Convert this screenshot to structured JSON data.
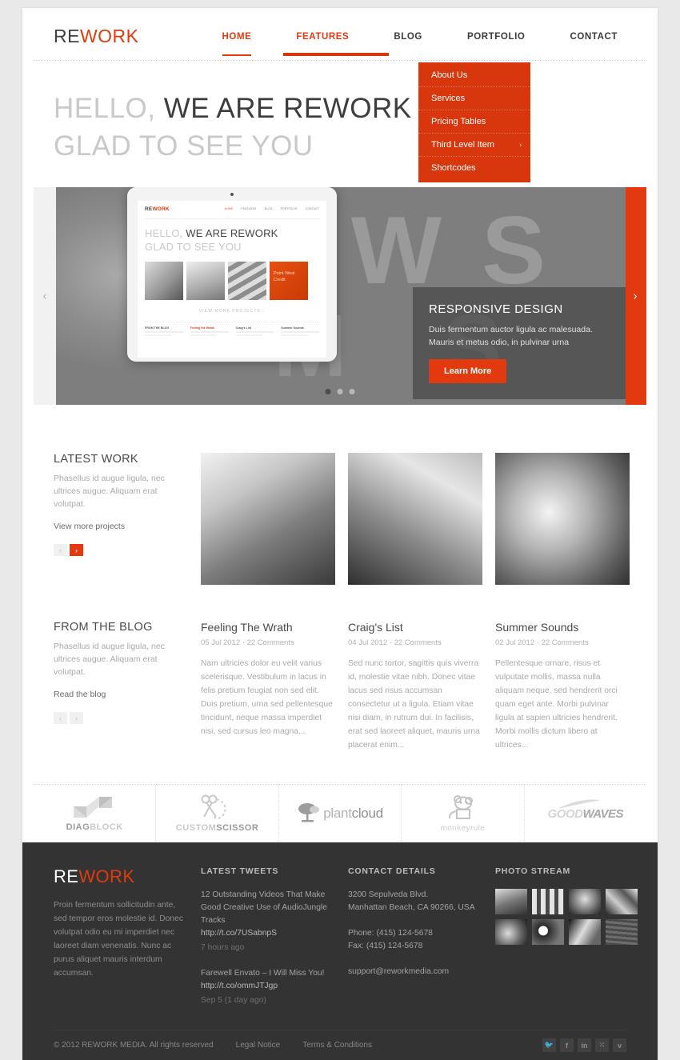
{
  "brand": {
    "part1": "RE",
    "part2": "WORK",
    "accent": "#e23a0e"
  },
  "nav": [
    {
      "label": "HOME",
      "state": "active"
    },
    {
      "label": "FEATURES",
      "state": "open"
    },
    {
      "label": "BLOG",
      "state": ""
    },
    {
      "label": "PORTFOLIO",
      "state": ""
    },
    {
      "label": "CONTACT",
      "state": ""
    }
  ],
  "dropdown": [
    {
      "label": "About Us",
      "arrow": ""
    },
    {
      "label": "Services",
      "arrow": ""
    },
    {
      "label": "Pricing Tables",
      "arrow": ""
    },
    {
      "label": "Third Level Item",
      "arrow": "›"
    },
    {
      "label": "Shortcodes",
      "arrow": ""
    }
  ],
  "hero": {
    "line1_light": "HELLO, ",
    "line1_dark": "WE ARE REWORK",
    "line2": "GLAD TO SEE YOU"
  },
  "slider": {
    "prev_icon": "‹",
    "next_icon": "›",
    "bg_letters": "NEWS",
    "bg_letters2": "M S",
    "caption": {
      "title": "RESPONSIVE DESIGN",
      "text": "Duis fermentum auctor ligula ac malesuada. Mauris et metus odio, in pulvinar urna",
      "button": "Learn More"
    },
    "dots": 3,
    "active_dot": 0,
    "tablet": {
      "logo1": "RE",
      "logo2": "WORK",
      "nav": [
        "HOME",
        "FEATURES",
        "BLOG",
        "PORTFOLIO",
        "CONTACT"
      ],
      "head_light": "HELLO, ",
      "head_dark": "WE ARE REWORK",
      "head_line2": "GLAD TO SEE YOU",
      "view_more": "VIEW MORE PROJECTS ›",
      "promo": "Point West Credit",
      "footer_cols": [
        "FROM THE BLOG",
        "Feeling the Wrath",
        "Craig's List",
        "Summer Sounds"
      ]
    }
  },
  "latest_work": {
    "title": "LATEST WORK",
    "desc": "Phasellus id augue ligula, nec ultrices augue. Aliquam erat volutpat.",
    "link": "View more projects",
    "prev": "‹",
    "next": "›"
  },
  "from_blog": {
    "title": "FROM THE BLOG",
    "desc": "Phasellus id augue ligula, nec ultrices augue. Aliquam erat volutpat.",
    "link": "Read the blog",
    "prev": "‹",
    "next": "›",
    "posts": [
      {
        "title": "Feeling The Wrath",
        "meta": "05 Jul 2012 · 22 Comments",
        "body": "Nam ultricies dolor eu velit varius scelerisque. Vestibulum in lacus in felis pretium feugiat non sed elit. Duis pretium, urna sed pellentesque tincidunt, neque massa imperdiet nisi, sed cursus leo magna..."
      },
      {
        "title": "Craig's List",
        "meta": "04 Jul 2012 · 22 Comments",
        "body": "Sed nunc tortor, sagittis quis viverra id, molestie vitae nibh. Donec vitae lacus sed risus accumsan consectetur ut a ligula. Etiam vitae nisi diam, in rutrum dui. In facilisis, erat sed laoreet aliquet, mauris urna placerat enim..."
      },
      {
        "title": "Summer Sounds",
        "meta": "02 Jul 2012 · 22 Comments",
        "body": "Pellentesque ornare, risus et vulputate mollis, massa nulla aliquam neque, sed hendrerit orci quam eget ante. Morbi pulvinar ligula at sapien ultricies hendrerit. Morbi mollis dictum libero at ultrices..."
      }
    ]
  },
  "clients": [
    {
      "name_a": "DIAG",
      "name_b": "BLOCK"
    },
    {
      "name_a": "CUSTOM",
      "name_b": "SCISSOR"
    },
    {
      "name_a": "plant",
      "name_b": "cloud"
    },
    {
      "name_a": "monkey",
      "name_b": "rule"
    },
    {
      "name_a": "GOOD",
      "name_b": "WAVES"
    }
  ],
  "footer": {
    "logo1": "RE",
    "logo2": "WORK",
    "about": "Proin fermentum sollicitudin ante, sed tempor eros molestie id. Donec volutpat odio eu mi imperdiet nec laoreet diam venenatis. Nunc ac purus aliquet mauris interdum accumsan.",
    "tweets_title": "LATEST TWEETS",
    "tweets": [
      {
        "text": "12 Outstanding Videos That Make Good Creative Use of AudioJungle Tracks",
        "url": "http://t.co/7USabnpS",
        "ago": "7 hours ago"
      },
      {
        "text": "Farewell Envato – I Will Miss You!",
        "url": "http://t.co/ommJTJgp",
        "ago": "Sep 5 (1 day ago)"
      }
    ],
    "contact_title": "CONTACT DETAILS",
    "address1": "3200 Sepulveda Blvd.",
    "address2": "Manhattan Beach, CA 90266, USA",
    "phone": "Phone: (415) 124-5678",
    "fax": "Fax: (415) 124-5678",
    "email": "support@reworkmedia.com",
    "photo_title": "PHOTO STREAM",
    "photo_count": 8,
    "copyright": "© 2012 REWORK MEDIA. All rights reserved",
    "legal": "Legal Notice",
    "terms": "Terms & Conditions",
    "social": [
      {
        "icon": "twitter-icon",
        "glyph": "🐦"
      },
      {
        "icon": "facebook-icon",
        "glyph": "f"
      },
      {
        "icon": "linkedin-icon",
        "glyph": "in"
      },
      {
        "icon": "flickr-icon",
        "glyph": "⁙"
      },
      {
        "icon": "vimeo-icon",
        "glyph": "v"
      }
    ]
  }
}
